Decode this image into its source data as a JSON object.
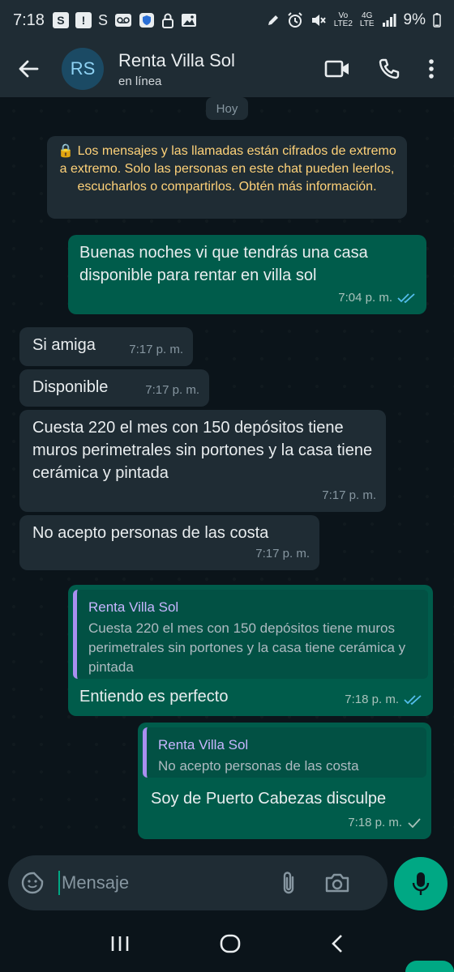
{
  "status_bar": {
    "time": "7:18",
    "left_icons": [
      "s-box-icon",
      "alert-box-icon",
      "s-letter-icon",
      "voicemail-icon",
      "shield-icon",
      "lock-icon",
      "image-icon"
    ],
    "right_icons": [
      "pen-icon",
      "alarm-icon",
      "mute-icon"
    ],
    "network_vo": "Vo",
    "network_lte2": "LTE2",
    "network_4g": "4G",
    "network_lte": "LTE",
    "battery": "9%"
  },
  "header": {
    "avatar_initials": "RS",
    "title": "Renta Villa Sol",
    "subtitle": "en línea"
  },
  "chat": {
    "day": "Hoy",
    "encryption_notice": "🔒 Los mensajes y las llamadas están cifrados de extremo a extremo. Solo las personas en este chat pueden leerlos, escucharlos o compartirlos. Obtén más información.",
    "messages": [
      {
        "dir": "out",
        "text": "Buenas noches vi que tendrás una casa disponible para rentar en villa sol",
        "time": "7:04 p. m.",
        "status": "read"
      },
      {
        "dir": "in",
        "text": "Si amiga",
        "time": "7:17 p. m."
      },
      {
        "dir": "in",
        "text": "Disponible",
        "time": "7:17 p. m."
      },
      {
        "dir": "in",
        "text": "Cuesta 220 el mes con 150 depósitos tiene muros perimetrales sin portones y la casa tiene cerámica y pintada",
        "time": "7:17 p. m."
      },
      {
        "dir": "in",
        "text": "No acepto personas de las costa",
        "time": "7:17 p. m."
      },
      {
        "dir": "out",
        "quote_name": "Renta Villa Sol",
        "quote_text": "Cuesta 220 el mes con 150 depósitos tiene muros perimetrales sin portones y la casa tiene cerámica y pintada",
        "text": "Entiendo es perfecto",
        "time": "7:18 p. m.",
        "status": "read"
      },
      {
        "dir": "out",
        "quote_name": "Renta Villa Sol",
        "quote_text": "No acepto personas de las costa",
        "text": "Soy de Puerto Cabezas disculpe",
        "time": "7:18 p. m.",
        "status": "sent"
      }
    ]
  },
  "composer": {
    "placeholder": "Mensaje"
  },
  "colors": {
    "accent": "#00a884",
    "outgoing_bubble": "#005c4b",
    "incoming_bubble": "#1f2c34",
    "read_ticks": "#53bdeb"
  }
}
